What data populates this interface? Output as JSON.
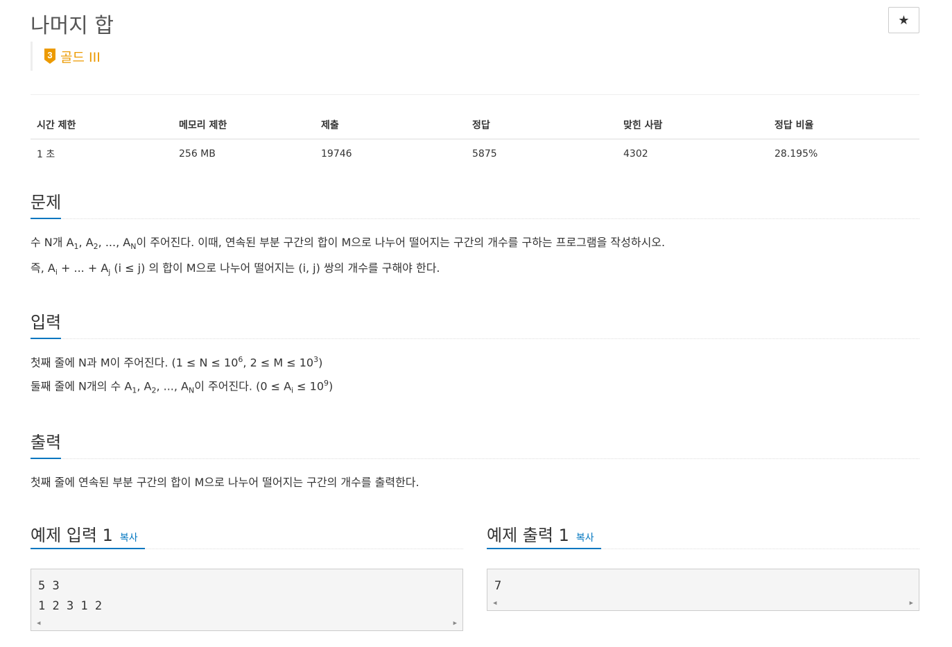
{
  "title": "나머지 합",
  "star_icon": "★",
  "tier": {
    "badge": "3",
    "label": "골드 III",
    "color": "#ec9a00"
  },
  "info_table": {
    "headers": [
      "시간 제한",
      "메모리 제한",
      "제출",
      "정답",
      "맞힌 사람",
      "정답 비율"
    ],
    "values": [
      "1 초",
      "256 MB",
      "19746",
      "5875",
      "4302",
      "28.195%"
    ]
  },
  "sections": {
    "problem": {
      "heading": "문제",
      "p1": {
        "a": "수 N개 A",
        "s1": "1",
        "b": ", A",
        "s2": "2",
        "c": ", ..., A",
        "s3": "N",
        "d": "이 주어진다. 이때, 연속된 부분 구간의 합이 M으로 나누어 떨어지는 구간의 개수를 구하는 프로그램을 작성하시오."
      },
      "p2": {
        "a": "즉, A",
        "s1": "i",
        "b": " + ... + A",
        "s2": "j",
        "c": " (i ≤ j) 의 합이 M으로 나누어 떨어지는 (i, j) 쌍의 개수를 구해야 한다."
      }
    },
    "input": {
      "heading": "입력",
      "p1": {
        "a": "첫째 줄에 N과 M이 주어진다. (1 ≤ N ≤ 10",
        "s1": "6",
        "b": ", 2 ≤ M ≤ 10",
        "s2": "3",
        "c": ")"
      },
      "p2": {
        "a": "둘째 줄에 N개의 수 A",
        "s1": "1",
        "b": ", A",
        "s2": "2",
        "c": ", ..., A",
        "s3": "N",
        "d": "이 주어진다. (0 ≤ A",
        "s4": "i",
        "e": " ≤ 10",
        "s5": "9",
        "f": ")"
      }
    },
    "output": {
      "heading": "출력",
      "p1": "첫째 줄에 연속된 부분 구간의 합이 M으로 나누어 떨어지는 구간의 개수를 출력한다."
    }
  },
  "samples": {
    "input": {
      "heading": "예제 입력 1",
      "copy": "복사",
      "lines": [
        "5 3",
        "1 2 3 1 2"
      ]
    },
    "output": {
      "heading": "예제 출력 1",
      "copy": "복사",
      "lines": [
        "7"
      ]
    }
  }
}
